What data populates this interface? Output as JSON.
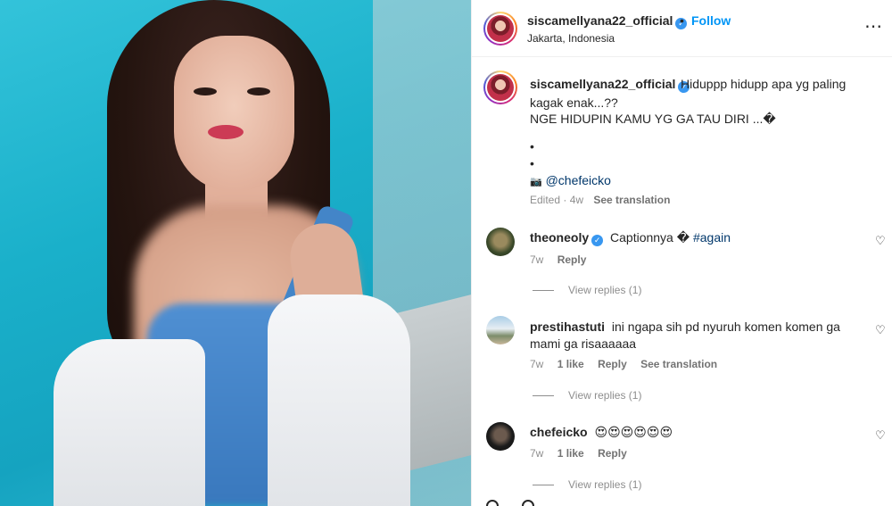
{
  "header": {
    "username": "siscamellyana22_official",
    "verified_mark": "✓",
    "separator": "•",
    "follow_label": "Follow",
    "location": "Jakarta, Indonesia",
    "more_icon": "⋯"
  },
  "caption": {
    "username": "siscamellyana22_official",
    "verified_mark": "✓",
    "line1": "Hiduppp hidupp apa yg paling",
    "line2": "kagak enak...??",
    "line3": "NGE HIDUPIN KAMU YG GA TAU DIRI ...�",
    "bullet1": "•",
    "bullet2": "•",
    "camera_icon": "📷",
    "mention": "@chefeicko",
    "age": "Edited · 4w",
    "see_translation": "See translation"
  },
  "comments": [
    {
      "username": "theoneoly",
      "verified_mark": "✓",
      "text": "Captionnya �",
      "hashtag": "#again",
      "age": "7w",
      "likes": "",
      "reply_label": "Reply",
      "see_translation": "",
      "view_replies": "View replies (1)"
    },
    {
      "username": "prestihastuti",
      "text": "ini ngapa sih pd nyuruh komen komen ga",
      "text2": "mami ga risaaaaaa",
      "age": "7w",
      "likes": "1 like",
      "reply_label": "Reply",
      "see_translation": "See translation",
      "view_replies": "View replies (1)"
    },
    {
      "username": "chefeicko",
      "text": "😍😍😍😍😍😍",
      "age": "7w",
      "likes": "1 like",
      "reply_label": "Reply",
      "view_replies": "View replies (1)"
    }
  ],
  "heart_icon": "♡",
  "colors": {
    "link_blue": "#0095f6",
    "mention_blue": "#00376b",
    "verified_blue": "#3897f0",
    "muted": "#8e8e8e"
  }
}
